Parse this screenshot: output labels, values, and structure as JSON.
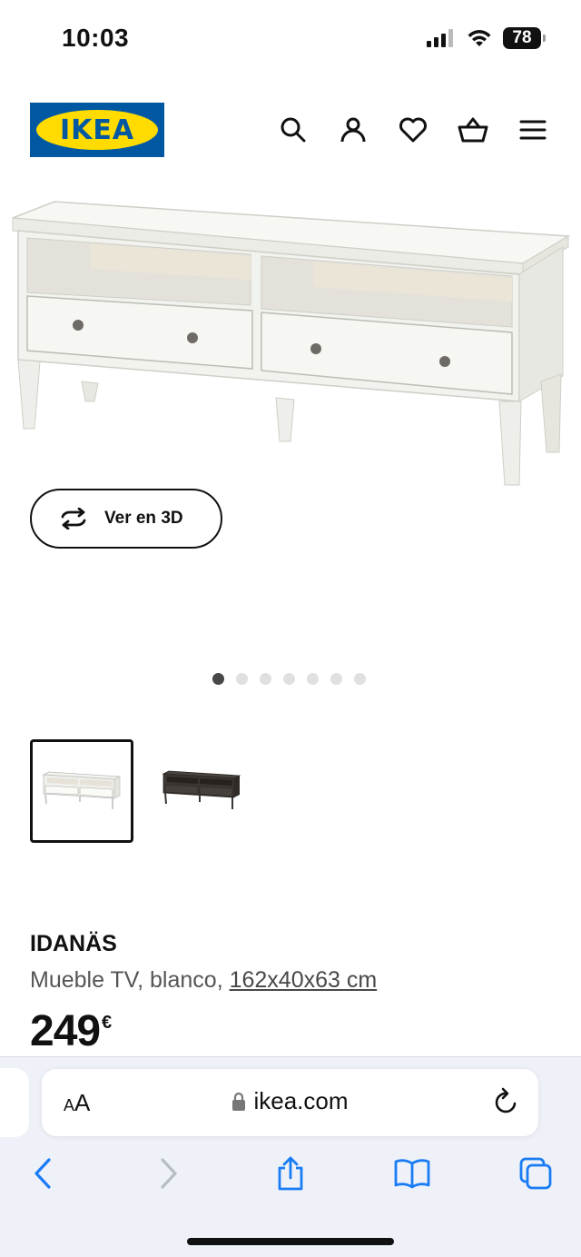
{
  "status": {
    "time": "10:03",
    "battery": "78"
  },
  "header": {
    "logo_text": "IKEA",
    "icons": [
      "search-icon",
      "user-icon",
      "heart-icon",
      "basket-icon",
      "menu-icon"
    ]
  },
  "product": {
    "view3d_label": "Ver en 3D",
    "gallery_dots": 7,
    "gallery_active": 0,
    "name": "IDANÄS",
    "description": "Mueble TV, blanco, ",
    "dimensions": "162x40x63 cm",
    "price": "249",
    "currency": "€",
    "variants": [
      "white",
      "dark-brown"
    ]
  },
  "browser": {
    "text_size_label_small": "A",
    "text_size_label_large": "A",
    "url": "ikea.com"
  },
  "colors": {
    "ikea_blue": "#0058a3",
    "ikea_yellow": "#ffdb00",
    "safari_blue": "#1a7cf5"
  }
}
